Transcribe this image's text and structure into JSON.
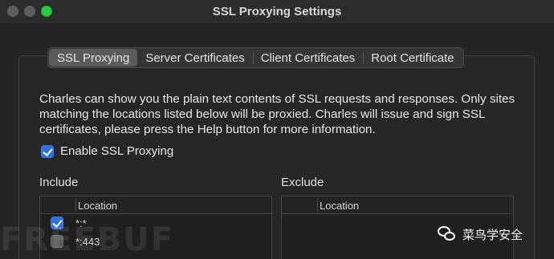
{
  "window": {
    "title": "SSL Proxying Settings"
  },
  "tabs": [
    {
      "label": "SSL Proxying",
      "active": true
    },
    {
      "label": "Server Certificates",
      "active": false
    },
    {
      "label": "Client Certificates",
      "active": false
    },
    {
      "label": "Root Certificate",
      "active": false
    }
  ],
  "description": "Charles can show you the plain text contents of SSL requests and responses. Only sites matching the locations listed below will be proxied. Charles will issue and sign SSL certificates, please press the Help button for more information.",
  "enable_ssl": {
    "label": "Enable SSL Proxying",
    "checked": true
  },
  "include": {
    "label": "Include",
    "column_header": "Location",
    "rows": [
      {
        "location": "*:*",
        "checked": true
      },
      {
        "location": "*:443",
        "checked": false
      }
    ]
  },
  "exclude": {
    "label": "Exclude",
    "column_header": "Location",
    "rows": []
  },
  "watermark": {
    "text": "FREEBUF",
    "account": "菜鸟学安全"
  },
  "colors": {
    "accent": "#2f6fe0",
    "background": "#242424"
  }
}
